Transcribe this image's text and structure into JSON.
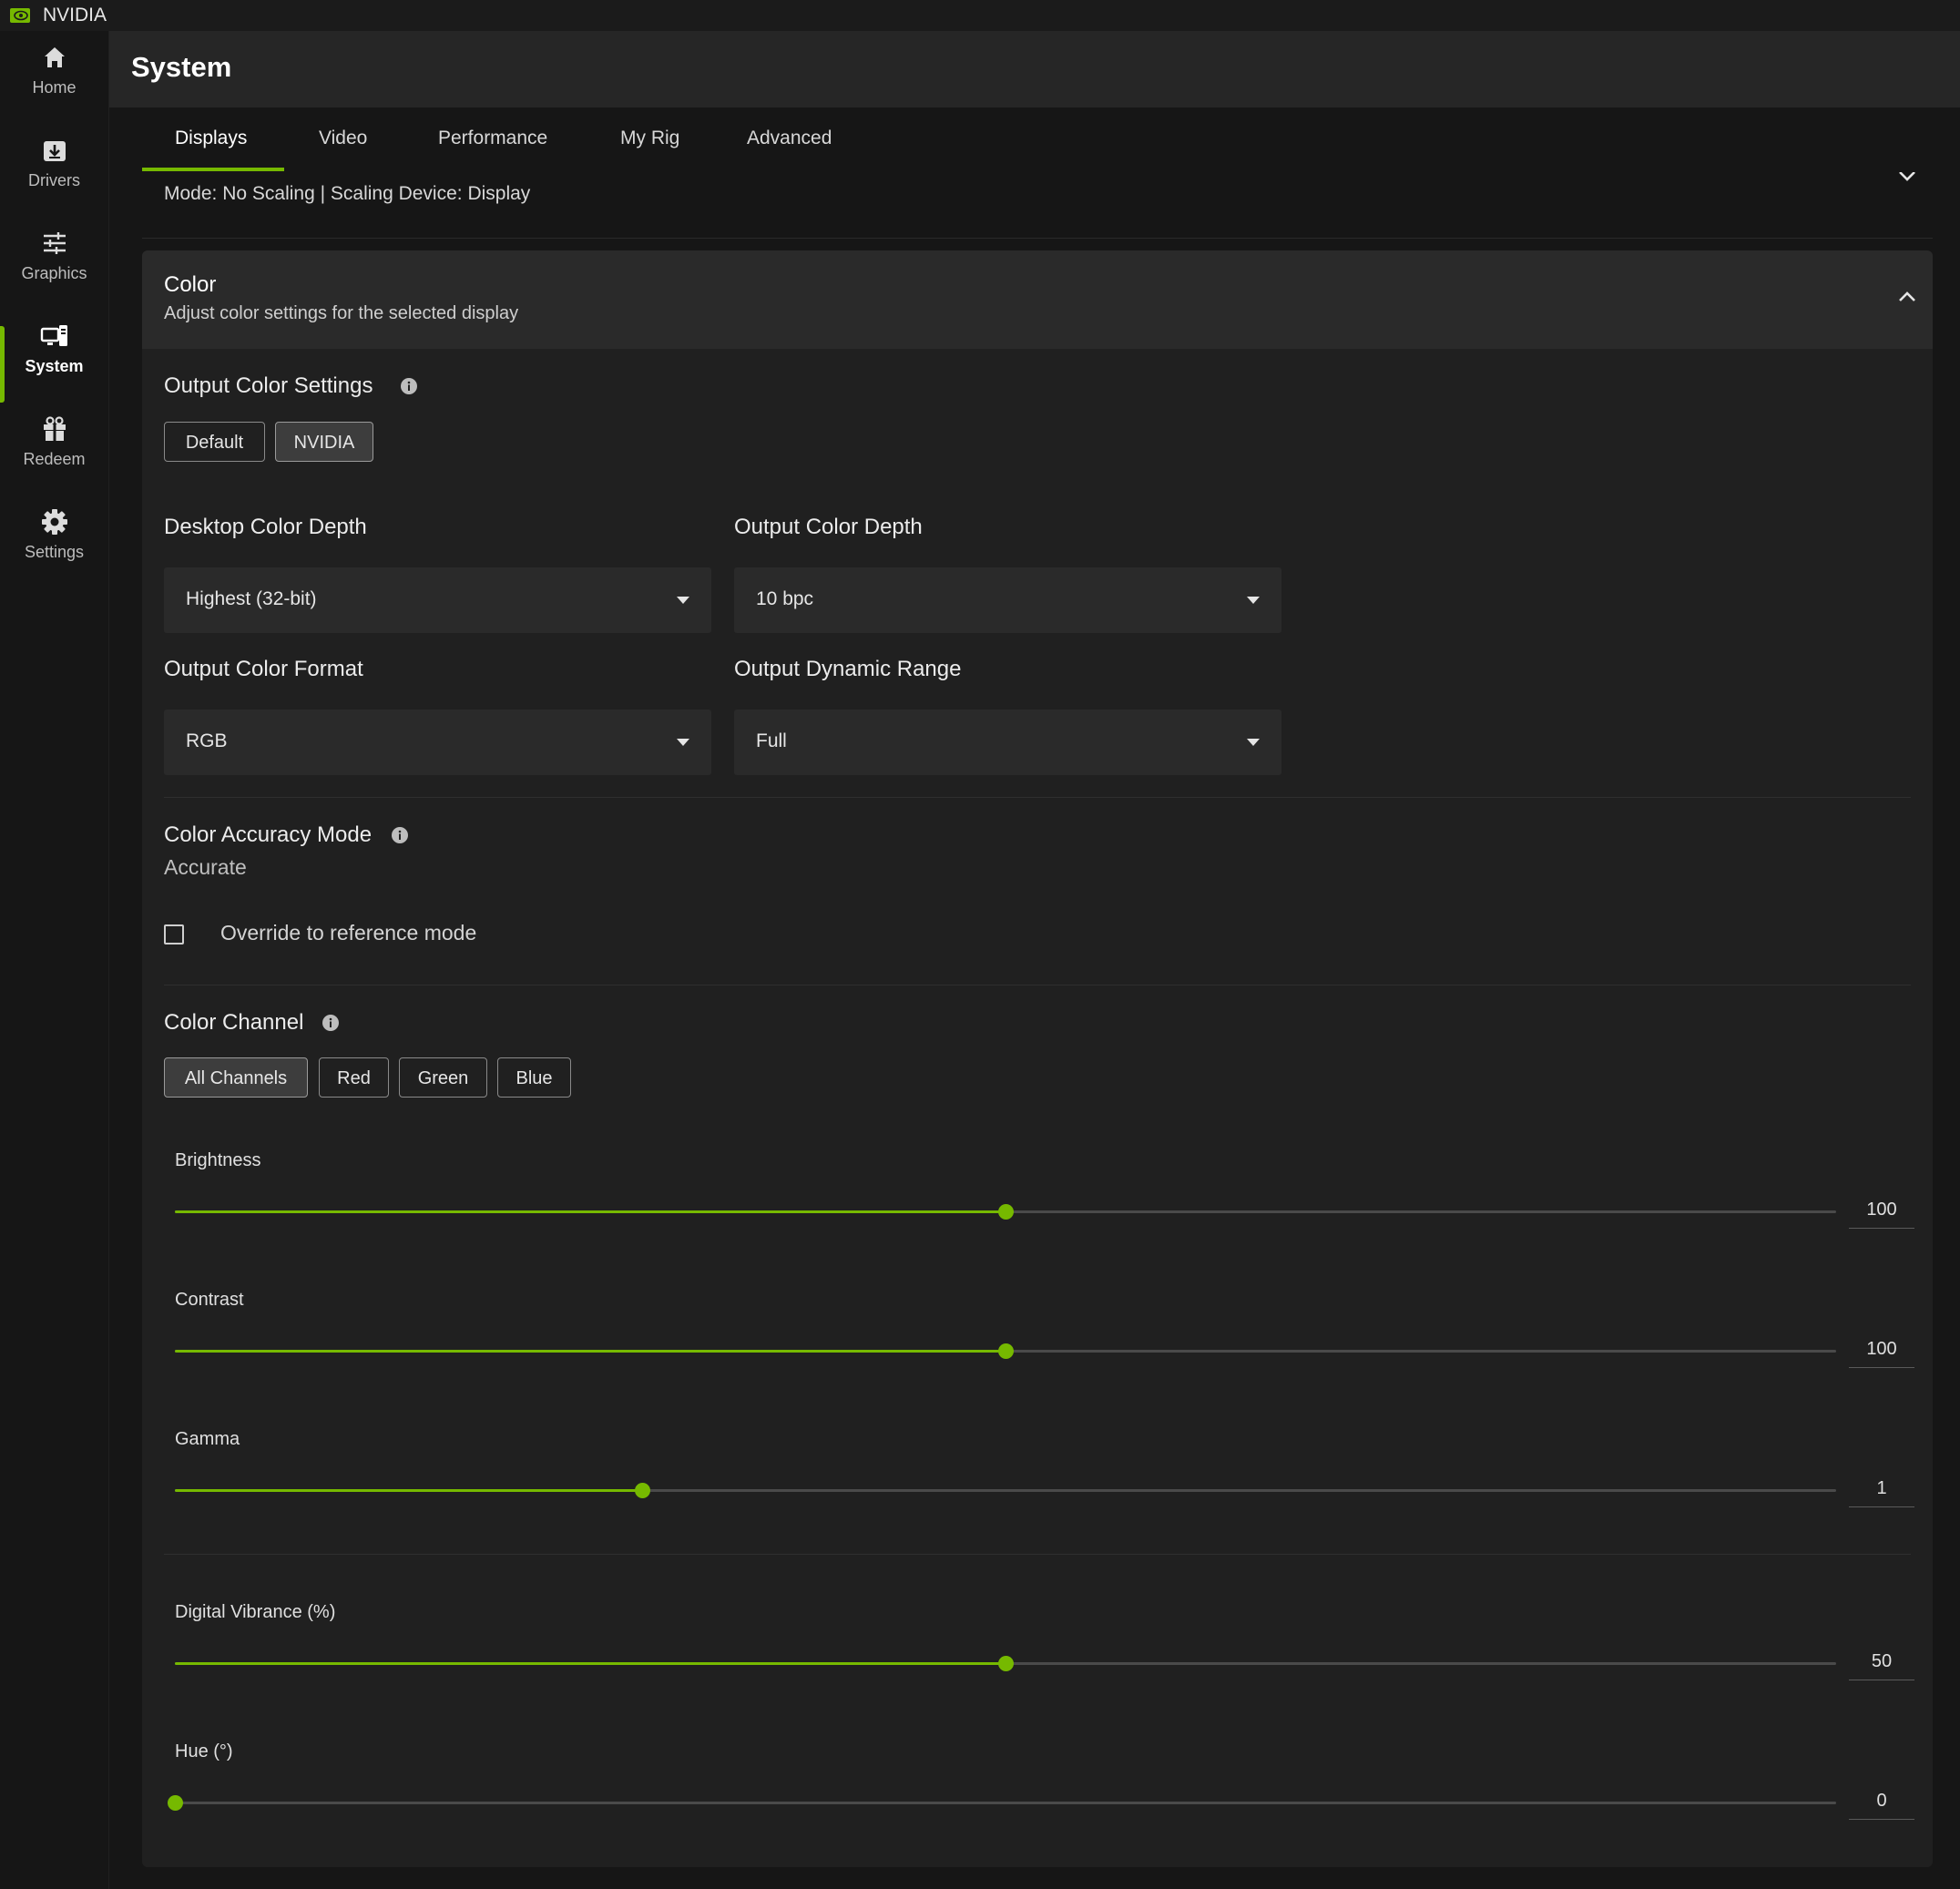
{
  "app": {
    "name": "NVIDIA",
    "logo_icon": "nvidia-eye-icon",
    "accent": "#76b900"
  },
  "sidebar": {
    "items": [
      {
        "label": "Home",
        "icon": "home-icon"
      },
      {
        "label": "Drivers",
        "icon": "download-icon"
      },
      {
        "label": "Graphics",
        "icon": "sliders-icon"
      },
      {
        "label": "System",
        "icon": "monitor-pc-icon",
        "active": true
      },
      {
        "label": "Redeem",
        "icon": "gift-icon"
      },
      {
        "label": "Settings",
        "icon": "gear-icon"
      }
    ]
  },
  "header": {
    "title": "System"
  },
  "tabs": [
    {
      "label": "Displays",
      "active": true
    },
    {
      "label": "Video"
    },
    {
      "label": "Performance"
    },
    {
      "label": "My Rig"
    },
    {
      "label": "Advanced"
    }
  ],
  "scaling": {
    "summary": "Mode: No Scaling | Scaling Device: Display"
  },
  "color": {
    "title": "Color",
    "subtitle": "Adjust color settings for the selected display",
    "output_settings": {
      "label": "Output Color Settings",
      "options": [
        "Default",
        "NVIDIA"
      ],
      "selected": "NVIDIA"
    },
    "desktop_color_depth": {
      "label": "Desktop Color Depth",
      "value": "Highest (32-bit)"
    },
    "output_color_depth": {
      "label": "Output Color Depth",
      "value": "10 bpc"
    },
    "output_color_format": {
      "label": "Output Color Format",
      "value": "RGB"
    },
    "output_dynamic_range": {
      "label": "Output Dynamic Range",
      "value": "Full"
    },
    "accuracy": {
      "label": "Color Accuracy Mode",
      "value": "Accurate",
      "override_label": "Override to reference mode",
      "override_checked": false
    },
    "channel": {
      "label": "Color Channel",
      "options": [
        "All Channels",
        "Red",
        "Green",
        "Blue"
      ],
      "selected": "All Channels"
    },
    "sliders": {
      "brightness": {
        "label": "Brightness",
        "value": "100",
        "fraction": 0.5
      },
      "contrast": {
        "label": "Contrast",
        "value": "100",
        "fraction": 0.5
      },
      "gamma": {
        "label": "Gamma",
        "value": "1",
        "fraction": 0.281
      },
      "vibrance": {
        "label": "Digital Vibrance (%)",
        "value": "50",
        "fraction": 0.5
      },
      "hue": {
        "label": "Hue (°)",
        "value": "0",
        "fraction": 0.0
      }
    }
  }
}
